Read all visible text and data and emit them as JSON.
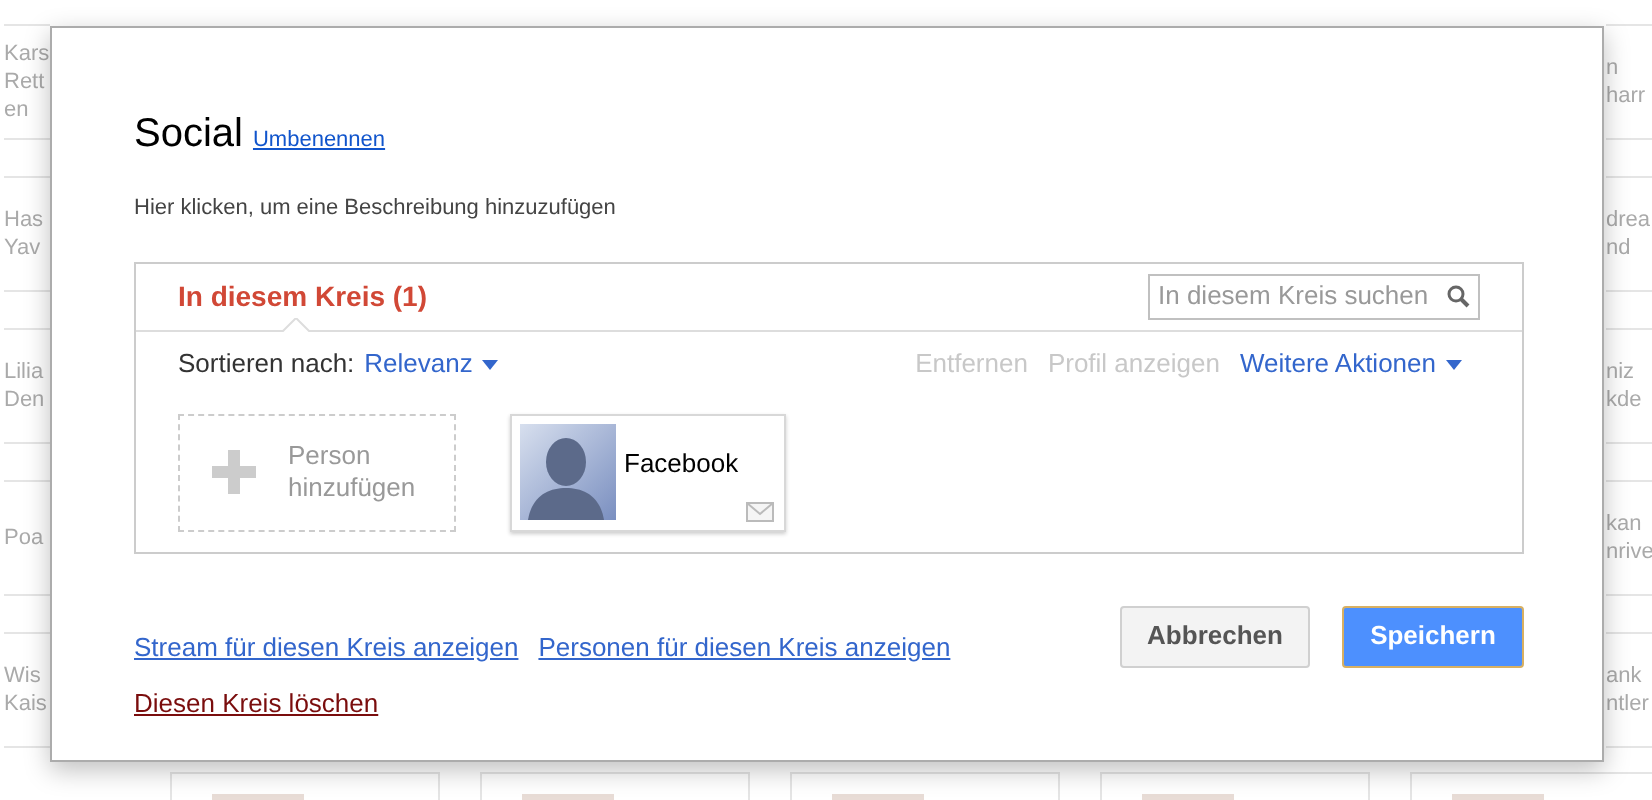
{
  "background": {
    "left": [
      {
        "lines": [
          "Kars",
          "Rett",
          "en"
        ]
      },
      {
        "lines": [
          "Has",
          "Yav"
        ]
      },
      {
        "lines": [
          "Lilia",
          "Den"
        ]
      },
      {
        "lines": [
          "Poa"
        ]
      },
      {
        "lines": [
          "Wis",
          "Kais"
        ]
      }
    ],
    "right": [
      {
        "lines": [
          "n",
          "harr"
        ]
      },
      {
        "lines": [
          "drea",
          "nd"
        ]
      },
      {
        "lines": [
          "niz",
          "kde"
        ]
      },
      {
        "lines": [
          "kan",
          "nrive"
        ]
      },
      {
        "lines": [
          "ank",
          "ntler"
        ]
      }
    ]
  },
  "dialog": {
    "title": "Social",
    "rename_link": "Umbenennen",
    "description": "Hier klicken, um eine Beschreibung hinzuzufügen",
    "panel": {
      "tab": {
        "label": "In diesem Kreis (1)",
        "selected": true
      },
      "search": {
        "placeholder": "In diesem Kreis suchen"
      },
      "sort_label": "Sortieren nach:",
      "sort_value": "Relevanz",
      "actions": [
        {
          "label": "Entfernen",
          "kind": "action",
          "disabled": true
        },
        {
          "label": "Profil anzeigen",
          "kind": "action",
          "disabled": true
        },
        {
          "label": "Weitere Aktionen",
          "kind": "menu",
          "disabled": false
        }
      ],
      "add_person": "Person hinzufügen",
      "people": [
        {
          "name": "Facebook"
        }
      ]
    },
    "links": [
      "Stream für diesen Kreis anzeigen",
      "Personen für diesen Kreis anzeigen"
    ],
    "delete_link": "Diesen Kreis löschen",
    "buttons": [
      {
        "label": "Abbrechen",
        "kind": "secondary"
      },
      {
        "label": "Speichern",
        "kind": "primary"
      }
    ]
  }
}
